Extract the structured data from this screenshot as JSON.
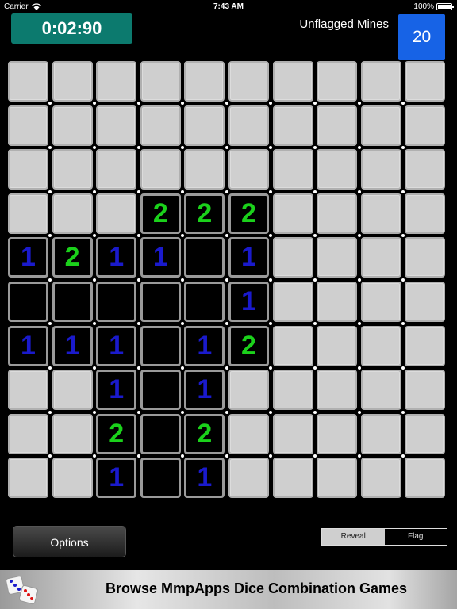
{
  "status_bar": {
    "carrier": "Carrier",
    "time": "7:43 AM",
    "battery": "100%"
  },
  "timer": "0:02:90",
  "mines": {
    "label": "Unflagged Mines",
    "count": "20"
  },
  "board": {
    "rows": [
      [
        "h",
        "h",
        "h",
        "h",
        "h",
        "h",
        "h",
        "h",
        "h",
        "h"
      ],
      [
        "h",
        "h",
        "h",
        "h",
        "h",
        "h",
        "h",
        "h",
        "h",
        "h"
      ],
      [
        "h",
        "h",
        "h",
        "h",
        "h",
        "h",
        "h",
        "h",
        "h",
        "h"
      ],
      [
        "h",
        "h",
        "h",
        "2",
        "2",
        "2",
        "h",
        "h",
        "h",
        "h"
      ],
      [
        "1",
        "2",
        "1",
        "1",
        "0",
        "1",
        "h",
        "h",
        "h",
        "h"
      ],
      [
        "0",
        "0",
        "0",
        "0",
        "0",
        "1",
        "h",
        "h",
        "h",
        "h"
      ],
      [
        "1",
        "1",
        "1",
        "0",
        "1",
        "2",
        "h",
        "h",
        "h",
        "h"
      ],
      [
        "h",
        "h",
        "1",
        "0",
        "1",
        "h",
        "h",
        "h",
        "h",
        "h"
      ],
      [
        "h",
        "h",
        "2",
        "0",
        "2",
        "h",
        "h",
        "h",
        "h",
        "h"
      ],
      [
        "h",
        "h",
        "1",
        "0",
        "1",
        "h",
        "h",
        "h",
        "h",
        "h"
      ]
    ]
  },
  "controls": {
    "options_label": "Options",
    "mode": [
      "Reveal",
      "Flag"
    ],
    "selected_mode": "Reveal"
  },
  "ad": {
    "text": "Browse MmpApps Dice Combination Games"
  },
  "colors": {
    "timer_bg": "#0c7a6e",
    "mines_bg": "#1763e6",
    "number_1": "#1a1acc",
    "number_2": "#1bd11b"
  }
}
